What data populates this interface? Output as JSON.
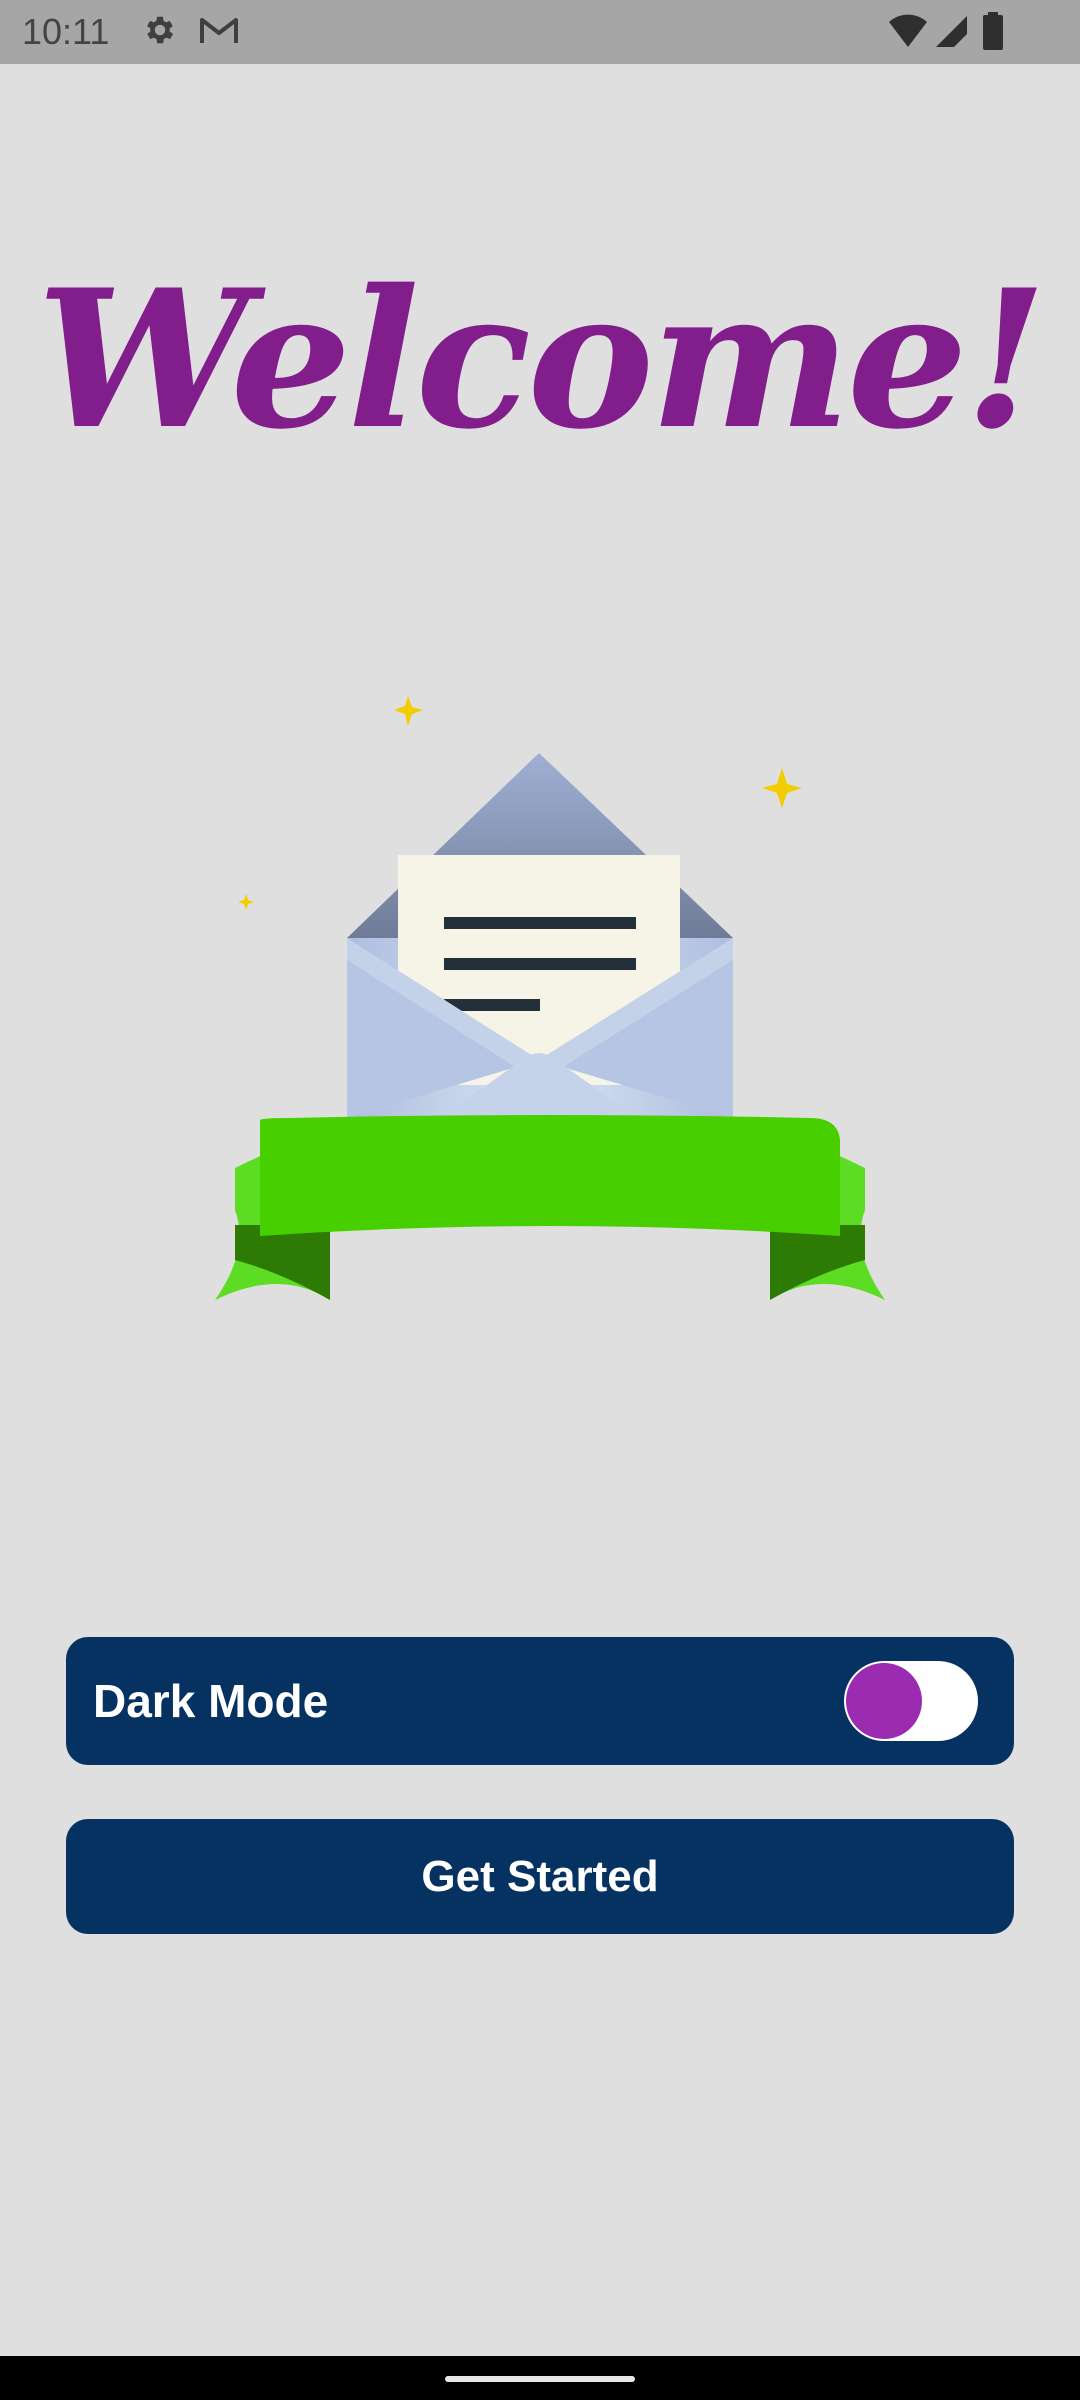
{
  "status_bar": {
    "time": "10:11",
    "icons_left": [
      "settings-gear-icon",
      "gmail-icon"
    ],
    "icons_right": [
      "wifi-icon",
      "cell-signal-icon",
      "battery-icon"
    ]
  },
  "welcome": {
    "title": "Welcome!",
    "title_color": "#821d8c"
  },
  "illustration": {
    "subject": "envelope-with-ribbon-icon",
    "ribbon_color": "#47cf00",
    "star_color": "#f2cd00"
  },
  "dark_mode": {
    "label": "Dark Mode",
    "enabled": false,
    "accent": "#9b2bb0"
  },
  "get_started": {
    "label": "Get Started"
  },
  "theme": {
    "primary": "#063261",
    "background": "#dfdfdf"
  }
}
